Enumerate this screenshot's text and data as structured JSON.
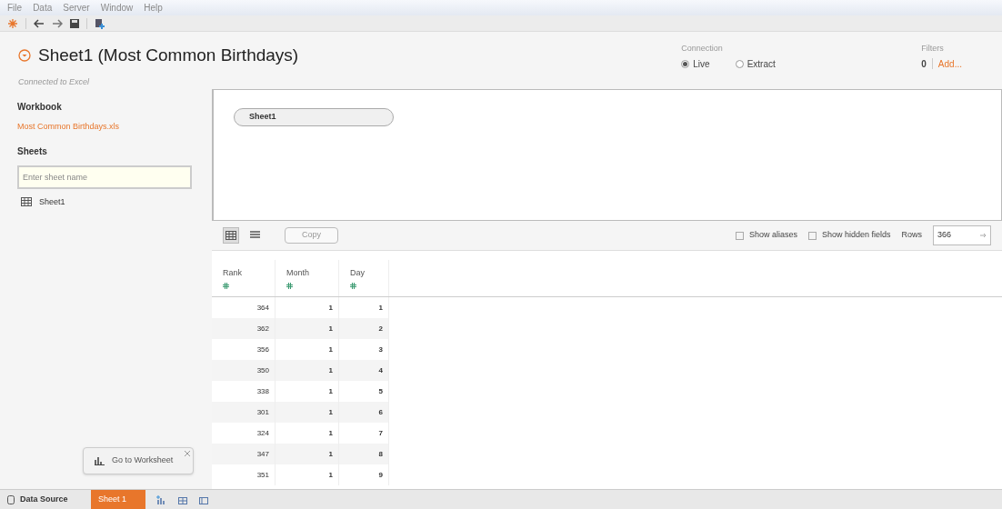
{
  "menu": [
    "File",
    "Data",
    "Server",
    "Window",
    "Help"
  ],
  "title": "Sheet1 (Most Common Birthdays)",
  "subtitle": "Connected to Excel",
  "connection": {
    "label": "Connection",
    "options": [
      {
        "label": "Live",
        "selected": true
      },
      {
        "label": "Extract",
        "selected": false
      }
    ]
  },
  "filters": {
    "label": "Filters",
    "count": "0",
    "add": "Add..."
  },
  "sidebar": {
    "workbook_heading": "Workbook",
    "workbook_file": "Most Common Birthdays.xls",
    "sheets_heading": "Sheets",
    "search": {
      "placeholder": "Enter sheet name"
    },
    "sheets": [
      "Sheet1"
    ]
  },
  "canvas": {
    "table_pill": "Sheet1"
  },
  "grid_toolbar": {
    "views": [
      {
        "kind": "grid",
        "selected": true
      },
      {
        "kind": "list",
        "selected": false
      }
    ],
    "copy": "Copy",
    "options": [
      {
        "label": "Show aliases",
        "checked": false
      },
      {
        "label": "Show hidden fields",
        "checked": false
      }
    ],
    "rows_label": "Rows",
    "rows_value": "366"
  },
  "table": {
    "columns": [
      "Rank",
      "Month",
      "Day"
    ],
    "rows": [
      [
        "364",
        "1",
        "1"
      ],
      [
        "362",
        "1",
        "2"
      ],
      [
        "356",
        "1",
        "3"
      ],
      [
        "350",
        "1",
        "4"
      ],
      [
        "338",
        "1",
        "5"
      ],
      [
        "301",
        "1",
        "6"
      ],
      [
        "324",
        "1",
        "7"
      ],
      [
        "347",
        "1",
        "8"
      ],
      [
        "351",
        "1",
        "9"
      ]
    ]
  },
  "tooltip": {
    "text": "Go to Worksheet"
  },
  "tabs": [
    {
      "kind": "source",
      "label": "Data Source",
      "selected": false
    },
    {
      "kind": "sheet",
      "label": "Sheet 1",
      "selected": true
    }
  ]
}
